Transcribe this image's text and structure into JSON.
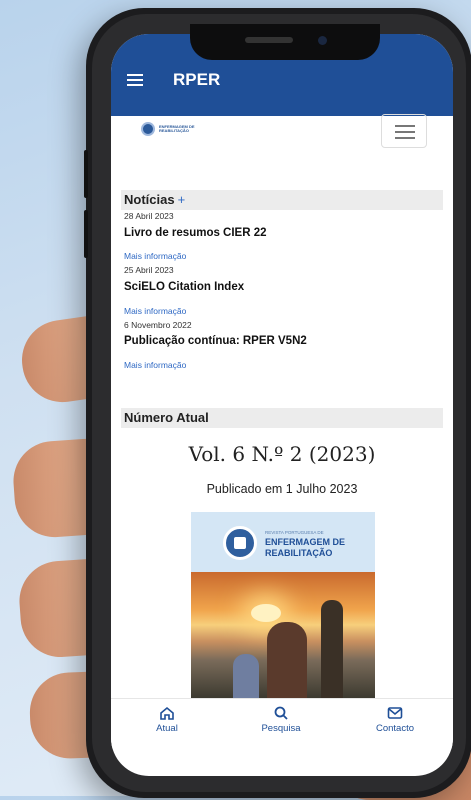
{
  "app": {
    "title": "RPER"
  },
  "logo": {
    "line1": "ENFERMAGEM DE",
    "line2": "REABILITAÇÃO"
  },
  "news": {
    "heading": "Notícias",
    "plus": "+",
    "items": [
      {
        "date": "28 Abril 2023",
        "title": "Livro de resumos CIER 22",
        "more": "Mais informação"
      },
      {
        "date": "25 Abril 2023",
        "title": "SciELO Citation Index",
        "more": "Mais informação"
      },
      {
        "date": "6 Novembro 2022",
        "title": "Publicação contínua: RPER V5N2",
        "more": "Mais informação"
      }
    ]
  },
  "current_issue": {
    "heading": "Número Atual",
    "volume": "Vol. 6 N.º 2 (2023)",
    "published": "Publicado em 1 Julho 2023",
    "cover": {
      "small": "REVISTA PORTUGUESA DE",
      "line1": "ENFERMAGEM DE",
      "line2": "REABILITAÇÃO"
    }
  },
  "bottom_nav": [
    {
      "label": "Atual",
      "icon": "home-icon"
    },
    {
      "label": "Pesquisa",
      "icon": "search-icon"
    },
    {
      "label": "Contacto",
      "icon": "mail-icon"
    }
  ],
  "colors": {
    "brand": "#1f4f97",
    "link": "#2f69c4"
  }
}
